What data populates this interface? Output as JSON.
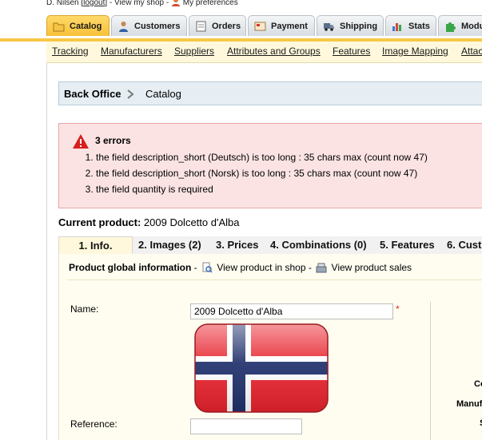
{
  "topbar": {
    "user": "D. Nilsen [",
    "logout": "logout",
    "after_logout": "] - View my shop -",
    "preferences": "My preferences"
  },
  "tabs": [
    {
      "label": "Catalog",
      "icon": "folder-icon",
      "active": true
    },
    {
      "label": "Customers",
      "icon": "customer-icon",
      "active": false
    },
    {
      "label": "Orders",
      "icon": "orders-icon",
      "active": false
    },
    {
      "label": "Payment",
      "icon": "payment-icon",
      "active": false
    },
    {
      "label": "Shipping",
      "icon": "truck-icon",
      "active": false
    },
    {
      "label": "Stats",
      "icon": "stats-icon",
      "active": false
    },
    {
      "label": "Modu",
      "icon": "puzzle-icon",
      "active": false
    }
  ],
  "subnav": [
    "Tracking",
    "Manufacturers",
    "Suppliers",
    "Attributes and Groups",
    "Features",
    "Image Mapping",
    "Attac"
  ],
  "breadcrumb": {
    "root": "Back Office",
    "current": "Catalog"
  },
  "errors": {
    "title": "3 errors",
    "items": [
      "the field description_short (Deutsch) is too long : 35 chars max (count now 47)",
      "the field description_short (Norsk) is too long : 35 chars max (count now 47)",
      "the field quantity is required"
    ]
  },
  "current_product": {
    "label": "Current product:",
    "name": "2009 Dolcetto d'Alba"
  },
  "steps": [
    "1. Info.",
    "2. Images (2)",
    "3. Prices",
    "4. Combinations (0)",
    "5. Features",
    "6. Custo"
  ],
  "global_info": {
    "title": "Product global information",
    "dash1": " - ",
    "view_shop": "View product in shop",
    "dash2": " - ",
    "view_sales": "View product sales"
  },
  "form": {
    "name_label": "Name:",
    "name_value": "2009 Dolcetto d'Alba",
    "required_mark": "*",
    "reference_label": "Reference:",
    "reference_value": ""
  },
  "right_cut": [
    "Co",
    "Manuf",
    "S"
  ],
  "colors": {
    "accent": "#f7c748",
    "error_bg": "#fbe3e3",
    "flag_red": "#e8222d",
    "flag_blue": "#1f2f6b"
  }
}
